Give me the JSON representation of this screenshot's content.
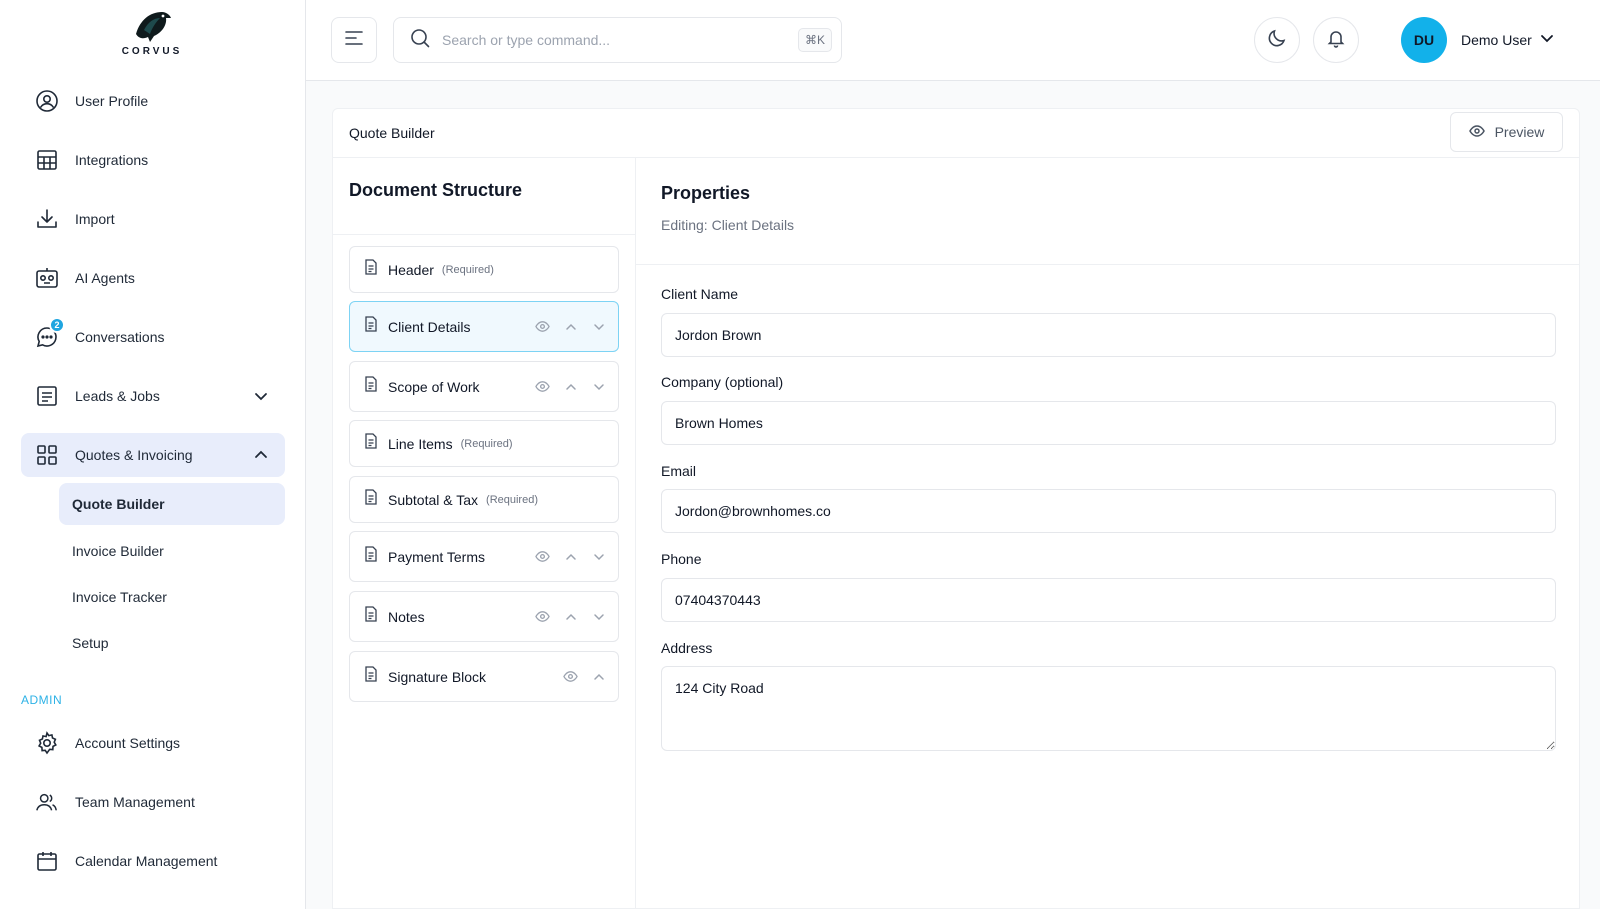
{
  "brand": {
    "name": "CORVUS"
  },
  "sidebar": {
    "items": [
      {
        "label": "User Profile",
        "icon": "user-circle-icon"
      },
      {
        "label": "Integrations",
        "icon": "table-grid-icon"
      },
      {
        "label": "Import",
        "icon": "download-icon"
      },
      {
        "label": "AI Agents",
        "icon": "robot-icon"
      },
      {
        "label": "Conversations",
        "icon": "chat-bubble-icon",
        "badge": "2"
      },
      {
        "label": "Leads & Jobs",
        "icon": "list-icon"
      },
      {
        "label": "Quotes & Invoicing",
        "icon": "grid-icon"
      }
    ],
    "sub_items": [
      {
        "label": "Quote Builder"
      },
      {
        "label": "Invoice Builder"
      },
      {
        "label": "Invoice Tracker"
      },
      {
        "label": "Setup"
      }
    ],
    "admin_label": "ADMIN",
    "admin_items": [
      {
        "label": "Account Settings",
        "icon": "gear-icon"
      },
      {
        "label": "Team Management",
        "icon": "users-icon"
      },
      {
        "label": "Calendar Management",
        "icon": "calendar-icon"
      }
    ]
  },
  "topbar": {
    "search_placeholder": "Search or type command...",
    "shortcut": "⌘K",
    "avatar_initials": "DU",
    "user_name": "Demo User"
  },
  "page": {
    "title": "Quote Builder",
    "preview_label": "Preview"
  },
  "structure": {
    "title": "Document Structure",
    "items": [
      {
        "label": "Header",
        "required": "(Required)"
      },
      {
        "label": "Client Details"
      },
      {
        "label": "Scope of Work"
      },
      {
        "label": "Line Items",
        "required": "(Required)"
      },
      {
        "label": "Subtotal & Tax",
        "required": "(Required)"
      },
      {
        "label": "Payment Terms"
      },
      {
        "label": "Notes"
      },
      {
        "label": "Signature Block"
      }
    ]
  },
  "properties": {
    "title": "Properties",
    "subtitle": "Editing: Client Details",
    "fields": {
      "client_name": {
        "label": "Client Name",
        "value": "Jordon Brown"
      },
      "company": {
        "label": "Company (optional)",
        "value": "Brown Homes"
      },
      "email": {
        "label": "Email",
        "value": "Jordon@brownhomes.co"
      },
      "phone": {
        "label": "Phone",
        "value": "07404370443"
      },
      "address": {
        "label": "Address",
        "value": "124 City Road"
      }
    }
  },
  "colors": {
    "accent": "#12b1ea",
    "active_bg": "#e8edfb",
    "admin_label": "#2eb2e6"
  }
}
